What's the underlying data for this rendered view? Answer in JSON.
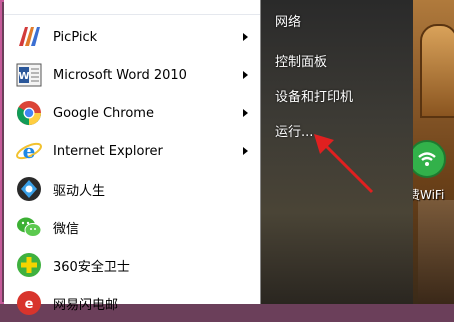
{
  "start_menu": {
    "programs": [
      {
        "label": "PicPick",
        "has_submenu": true,
        "icon": "picpick-icon"
      },
      {
        "label": "Microsoft Word 2010",
        "has_submenu": true,
        "icon": "word-icon"
      },
      {
        "label": "Google Chrome",
        "has_submenu": true,
        "icon": "chrome-icon"
      },
      {
        "label": "Internet Explorer",
        "has_submenu": true,
        "icon": "ie-icon"
      },
      {
        "label": "驱动人生",
        "has_submenu": false,
        "icon": "driver-life-icon"
      },
      {
        "label": "微信",
        "has_submenu": false,
        "icon": "wechat-icon"
      },
      {
        "label": "360安全卫士",
        "has_submenu": false,
        "icon": "360-icon"
      },
      {
        "label": "网易闪电邮",
        "has_submenu": false,
        "icon": "netease-mail-icon"
      }
    ],
    "right_items": [
      {
        "label": "网络"
      },
      {
        "label": "控制面板"
      },
      {
        "label": "设备和打印机"
      },
      {
        "label": "运行..."
      }
    ]
  },
  "desktop": {
    "wifi_label": "费WiFi"
  },
  "colors": {
    "frame_border": "#c65a9a",
    "annotation_arrow": "#e02020",
    "right_panel": "#3d3b35"
  }
}
